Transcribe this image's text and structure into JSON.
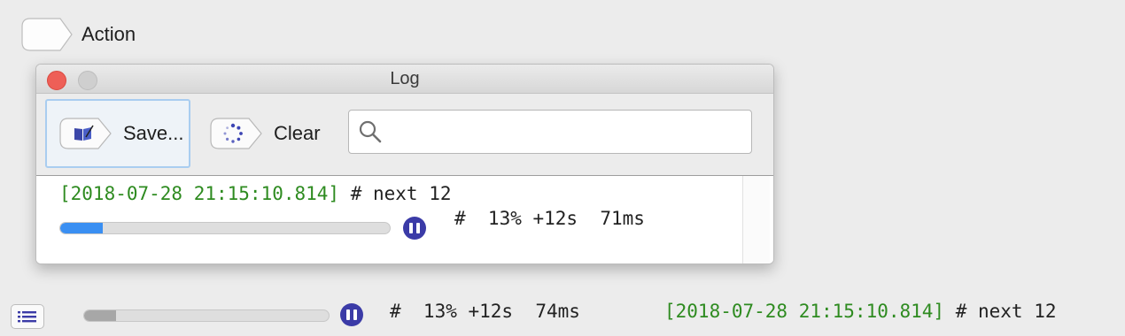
{
  "action": {
    "label": "Action"
  },
  "window": {
    "title": "Log",
    "toolbar": {
      "save_label": "Save...",
      "clear_label": "Clear",
      "search": {
        "value": "",
        "placeholder": ""
      }
    },
    "log": {
      "timestamp": "[2018-07-28 21:15:10.814]",
      "message": " # next 12",
      "progress_percent": 13,
      "stats": "#  13% +12s  71ms"
    }
  },
  "status_bar": {
    "progress_percent": 13,
    "stats": "#  13% +12s  74ms",
    "timestamp": "[2018-07-28 21:15:10.814]",
    "message": " # next 12"
  },
  "colors": {
    "timestamp": "#2e8b20",
    "accent_progress": "#3a8ff2",
    "pause_icon": "#3b3ba7"
  },
  "icons": [
    "action-tag-icon",
    "save-book-icon",
    "clear-spinner-icon",
    "search-icon",
    "pause-icon",
    "list-icon"
  ]
}
